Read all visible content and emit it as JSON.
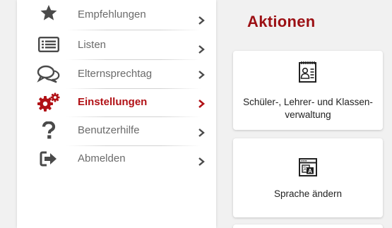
{
  "sidebar": {
    "items": [
      {
        "label": "Empfehlungen",
        "icon": "star-icon",
        "active": false
      },
      {
        "label": "Listen",
        "icon": "list-icon",
        "active": false
      },
      {
        "label": "Elternsprechtag",
        "icon": "chat-bubbles-icon",
        "active": false
      },
      {
        "label": "Einstellungen",
        "icon": "gears-icon",
        "active": true
      },
      {
        "label": "Benutzerhilfe",
        "icon": "question-mark-icon",
        "active": false
      },
      {
        "label": "Abmelden",
        "icon": "sign-out-icon",
        "active": false
      }
    ]
  },
  "main": {
    "title": "Aktionen",
    "cards": [
      {
        "label": "Schüler-, Lehrer- und Klassenverwaltung",
        "label_line1": "Schüler-, Lehrer- und Klassen-",
        "label_line2": "verwaltung",
        "icon": "address-book-icon"
      },
      {
        "label": "Sprache ändern",
        "icon": "language-window-icon"
      }
    ]
  },
  "colors": {
    "accent": "#b11116",
    "title": "#9c1014",
    "icon_dark": "#4a4a4a",
    "text_muted": "#6b6b6b",
    "background": "#f1f1f1"
  }
}
